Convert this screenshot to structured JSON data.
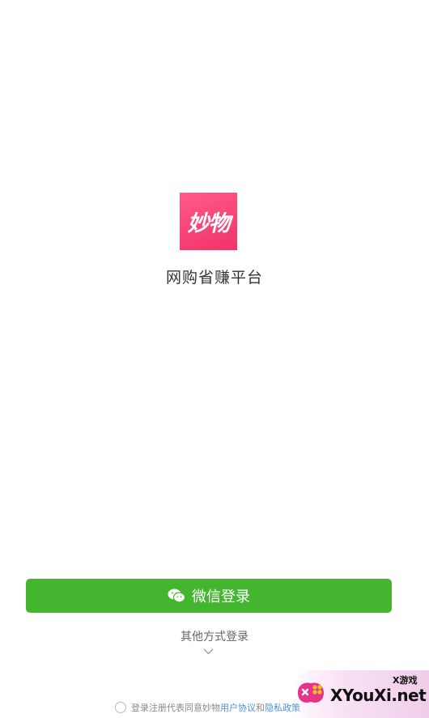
{
  "app": {
    "logo_text": "妙物",
    "tagline": "网购省赚平台"
  },
  "login": {
    "wechat_button_label": "微信登录",
    "other_methods_label": "其他方式登录"
  },
  "agreement": {
    "prefix": "登录注册代表同意妙物",
    "user_agreement": "用户协议",
    "and": "和",
    "privacy_policy": "隐私政策"
  },
  "watermark": {
    "brand_cn": "X游戏",
    "brand": "XYouXi.net"
  },
  "colors": {
    "brand_pink": "#f0336a",
    "wechat_green": "#44b52f",
    "link_blue": "#4a90d9"
  },
  "icons": {
    "wechat": "wechat-icon",
    "expand": "chevron-down-icon"
  }
}
